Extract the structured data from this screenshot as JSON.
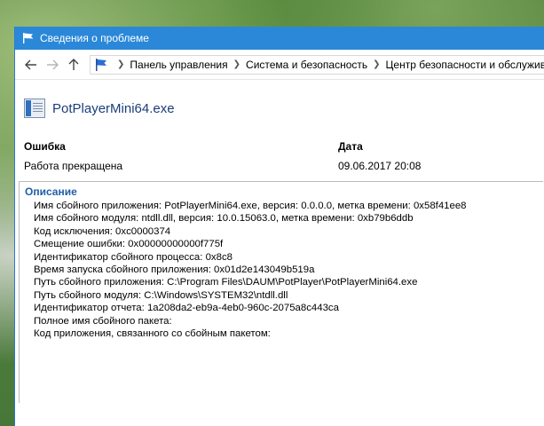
{
  "window": {
    "title": "Сведения о проблеме"
  },
  "nav": {
    "breadcrumb": [
      "Панель управления",
      "Система и безопасность",
      "Центр безопасности и обслуживания"
    ]
  },
  "app": {
    "name": "PotPlayerMini64.exe"
  },
  "summary": {
    "col1_header": "Ошибка",
    "col2_header": "Дата",
    "col1_value": "Работа прекращена",
    "col2_value": "09.06.2017 20:08"
  },
  "description": {
    "title": "Описание",
    "lines": [
      "Имя сбойного приложения: PotPlayerMini64.exe, версия: 0.0.0.0, метка времени: 0x58f41ee8",
      "Имя сбойного модуля: ntdll.dll, версия: 10.0.15063.0, метка времени: 0xb79b6ddb",
      "Код исключения: 0xc0000374",
      "Смещение ошибки: 0x00000000000f775f",
      "Идентификатор сбойного процесса: 0x8c8",
      "Время запуска сбойного приложения: 0x01d2e143049b519a",
      "Путь сбойного приложения: C:\\Program Files\\DAUM\\PotPlayer\\PotPlayerMini64.exe",
      "Путь сбойного модуля: C:\\Windows\\SYSTEM32\\ntdll.dll",
      "Идентификатор отчета: 1a208da2-eb9a-4eb0-960c-2075a8c443ca",
      "Полное имя сбойного пакета:",
      "Код приложения, связанного со сбойным пакетом:"
    ]
  },
  "colors": {
    "titlebar": "#2b88d8",
    "link_blue": "#1f5fa8"
  }
}
